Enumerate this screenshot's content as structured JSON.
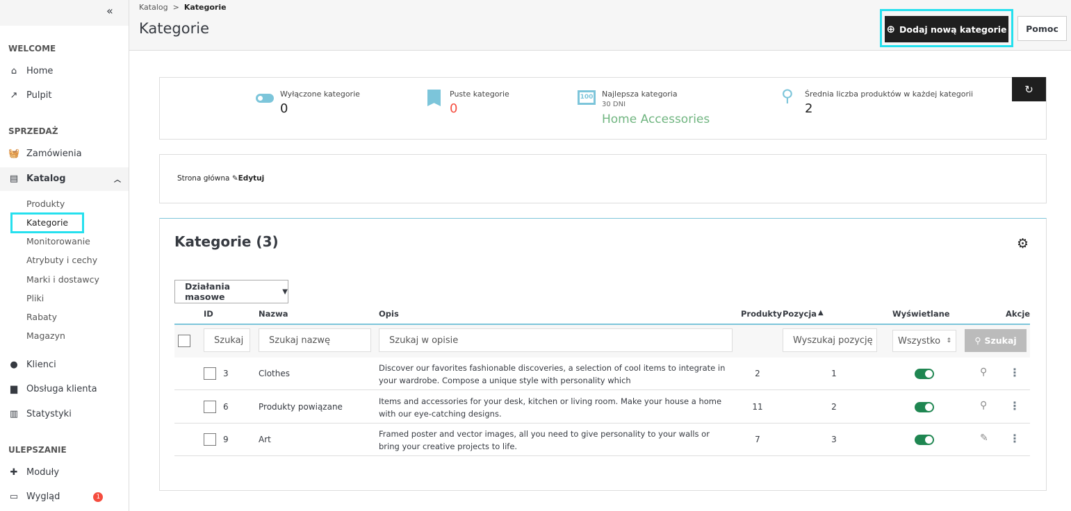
{
  "sidebar": {
    "collapse_icon": "double-chevron-left",
    "sections": [
      {
        "title": "WELCOME",
        "items": [
          {
            "label": "Home",
            "icon": "home"
          },
          {
            "label": "Pulpit",
            "icon": "trending-up"
          }
        ]
      },
      {
        "title": "SPRZEDAŻ",
        "items": [
          {
            "label": "Zamówienia",
            "icon": "basket"
          },
          {
            "label": "Katalog",
            "icon": "store"
          }
        ]
      },
      {
        "title": "ULEPSZANIE",
        "items": [
          {
            "label": "Moduły",
            "icon": "puzzle"
          },
          {
            "label": "Wygląd",
            "icon": "monitor",
            "badge": "1"
          }
        ]
      }
    ],
    "catalog_sub": [
      "Produkty",
      "Kategorie",
      "Monitorowanie",
      "Atrybuty i cechy",
      "Marki i dostawcy",
      "Pliki",
      "Rabaty",
      "Magazyn"
    ],
    "more": [
      {
        "label": "Klienci",
        "icon": "account"
      },
      {
        "label": "Obsługa klienta",
        "icon": "chat"
      },
      {
        "label": "Statystyki",
        "icon": "bar-chart"
      }
    ]
  },
  "header": {
    "breadcrumb": [
      "Katalog",
      ">",
      "Kategorie"
    ],
    "title": "Kategorie",
    "add_button": "Dodaj nową kategorie",
    "help_button": "Pomoc"
  },
  "kpis": [
    {
      "label": "Wyłączone kategorie",
      "value": "0",
      "icon": "toggle"
    },
    {
      "label": "Puste kategorie",
      "value": "0",
      "icon": "bookmark",
      "color": "#f54c3e"
    },
    {
      "label": "Najlepsza kategoria",
      "sub": "30 DNI",
      "value": "Home Accessories",
      "icon": "counter",
      "color": "#70b580"
    },
    {
      "label": "Średnia liczba produktów w każdej kategorii",
      "value": "2",
      "icon": "search"
    }
  ],
  "home": {
    "label": "Strona główna",
    "edit": "Edytuj"
  },
  "list": {
    "title": "Kategorie (3)",
    "bulk": "Działania masowe",
    "columns": {
      "id": "ID",
      "name": "Nazwa",
      "desc": "Opis",
      "products": "Produkty",
      "position": "Pozycja",
      "displayed": "Wyświetlane",
      "actions": "Akcje"
    },
    "filters": {
      "id": "Szukaj",
      "name": "Szukaj nazwę",
      "desc": "Szukaj w opisie",
      "position": "Wyszukaj pozycję",
      "displayed": "Wszystko",
      "search": "Szukaj"
    },
    "rows": [
      {
        "id": "3",
        "name": "Clothes",
        "desc": "Discover our favorites fashionable discoveries, a selection of cool items to integrate in your wardrobe. Compose a unique style with personality which",
        "products": "2",
        "position": "1",
        "displayed": true,
        "action": "zoom"
      },
      {
        "id": "6",
        "name": "Produkty powiązane",
        "desc": "Items and accessories for your desk, kitchen or living room. Make your house a home with our eye-catching designs.",
        "products": "11",
        "position": "2",
        "displayed": true,
        "action": "zoom"
      },
      {
        "id": "9",
        "name": "Art",
        "desc": "Framed poster and vector images, all you need to give personality to your walls or bring your creative projects to life.",
        "products": "7",
        "position": "3",
        "displayed": true,
        "action": "edit"
      }
    ]
  },
  "colors": {
    "accent": "#25b9d7",
    "highlight": "#25e0ee",
    "toggle_on": "#1f8651"
  }
}
